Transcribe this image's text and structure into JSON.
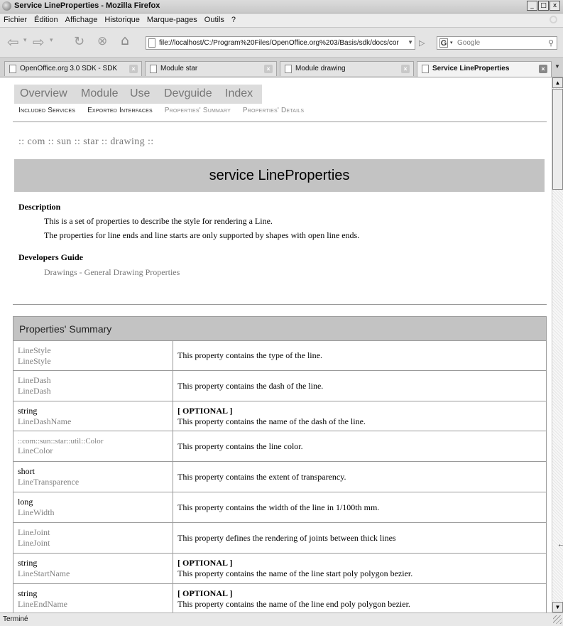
{
  "window": {
    "title": "Service LineProperties - Mozilla Firefox",
    "controls": [
      "_",
      "□",
      "x"
    ]
  },
  "menubar": [
    "Fichier",
    "Édition",
    "Affichage",
    "Historique",
    "Marque-pages",
    "Outils",
    "?"
  ],
  "navigation": {
    "url": "file://localhost/C:/Program%20Files/OpenOffice.org%203/Basis/sdk/docs/cor",
    "search_placeholder": "Google",
    "search_engine_icon": "G"
  },
  "tabs": [
    {
      "label": "OpenOffice.org 3.0 SDK - SDK",
      "active": false
    },
    {
      "label": "Module star",
      "active": false
    },
    {
      "label": "Module drawing",
      "active": false
    },
    {
      "label": "Service LineProperties",
      "active": true
    }
  ],
  "page": {
    "topnav": [
      "Overview",
      "Module",
      "Use",
      "Devguide",
      "Index"
    ],
    "subnav": [
      {
        "label": "Included Services",
        "enabled": true
      },
      {
        "label": "Exported Interfaces",
        "enabled": true
      },
      {
        "label": "Properties' Summary",
        "enabled": false
      },
      {
        "label": "Properties' Details",
        "enabled": false
      }
    ],
    "breadcrumb": ":: com :: sun :: star :: drawing ::",
    "service_title": "service LineProperties",
    "description_heading": "Description",
    "description_lines": [
      "This is a set of properties to describe the style for rendering a Line.",
      "The properties for line ends and line starts are only supported by shapes with open line ends."
    ],
    "devguide_heading": "Developers Guide",
    "devguide_link": "Drawings - General Drawing Properties",
    "summary_heading": "Properties' Summary",
    "properties": [
      {
        "type": "LineStyle",
        "type_link": true,
        "name": "LineStyle",
        "optional": "",
        "desc": "This property contains the type of the line."
      },
      {
        "type": "LineDash",
        "type_link": true,
        "name": "LineDash",
        "optional": "",
        "desc": "This property contains the dash of the line."
      },
      {
        "type": "string",
        "type_link": false,
        "name": "LineDashName",
        "optional": "[ OPTIONAL ]",
        "desc": "This property contains the name of the dash of the line."
      },
      {
        "type": "::com::sun::star::util::Color",
        "type_link": true,
        "name": "LineColor",
        "optional": "",
        "desc": "This property contains the line color."
      },
      {
        "type": "short",
        "type_link": false,
        "name": "LineTransparence",
        "optional": "",
        "desc": "This property contains the extent of transparency."
      },
      {
        "type": "long",
        "type_link": false,
        "name": "LineWidth",
        "optional": "",
        "desc": "This property contains the width of the line in 1/100th mm."
      },
      {
        "type": "LineJoint",
        "type_link": true,
        "name": "LineJoint",
        "optional": "",
        "desc": "This property defines the rendering of joints between thick lines"
      },
      {
        "type": "string",
        "type_link": false,
        "name": "LineStartName",
        "optional": "[ OPTIONAL ]",
        "desc": "This property contains the name of the line start poly polygon bezier."
      },
      {
        "type": "string",
        "type_link": false,
        "name": "LineEndName",
        "optional": "[ OPTIONAL ]",
        "desc": "This property contains the name of the line end poly polygon bezier."
      }
    ]
  },
  "status": "Terminé"
}
